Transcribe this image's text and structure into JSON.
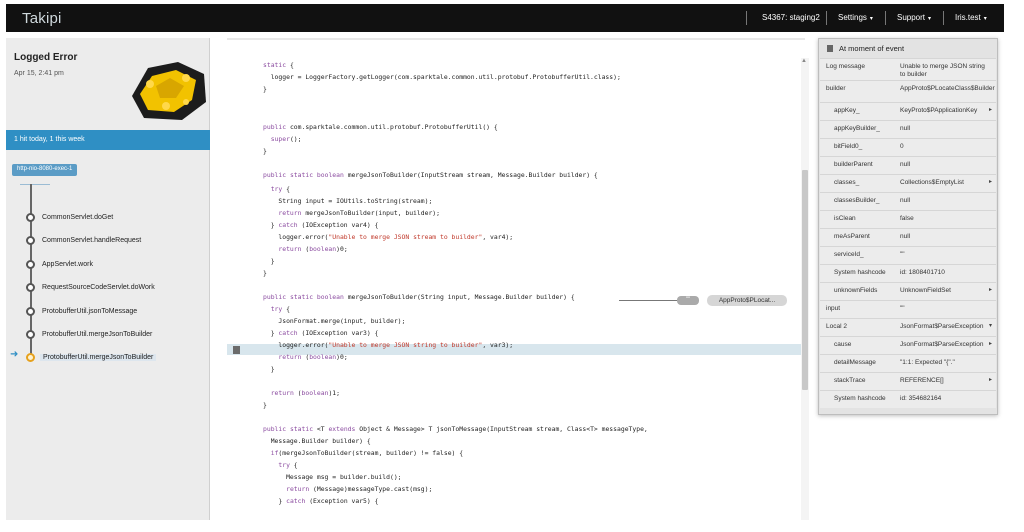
{
  "topbar": {
    "logo": "Takipi",
    "env": "S4367: staging2",
    "settings": "Settings",
    "support": "Support",
    "user": "Iris.test",
    "caret": "▾"
  },
  "left": {
    "title": "Logged Error",
    "datetime": "Apr 15, 2:41 pm",
    "hits": "1 hit today, 1 this week",
    "thread": "http-nio-8080-exec-1",
    "frames": [
      "CommonServlet.doGet",
      "CommonServlet.handleRequest",
      "AppServlet.work",
      "RequestSourceCodeServlet.doWork",
      "ProtobufferUtil.jsonToMessage",
      "ProtobufferUtil.mergeJsonToBuilder",
      "ProtobufferUtil.mergeJsonToBuilder"
    ]
  },
  "code": {
    "lines": [
      "static {",
      "  logger = LoggerFactory.getLogger(com.sparktale.common.util.protobuf.ProtobufferUtil.class);",
      "}",
      "",
      "",
      "public com.sparktale.common.util.protobuf.ProtobufferUtil() {",
      "  super();",
      "}",
      "",
      "public static boolean mergeJsonToBuilder(InputStream stream, Message.Builder builder) {",
      "  try {",
      "    String input = IOUtils.toString(stream);",
      "    return mergeJsonToBuilder(input, builder);",
      "  } catch (IOException var4) {",
      "    logger.error(\"Unable to merge JSON stream to builder\", var4);",
      "    return (boolean)0;",
      "  }",
      "}",
      "",
      "public static boolean mergeJsonToBuilder(String input, Message.Builder builder) {",
      "  try {",
      "    JsonFormat.merge(input, builder);",
      "  } catch (IOException var3) {",
      "    logger.error(\"Unable to merge JSON string to builder\", var3);",
      "    return (boolean)0;",
      "  }",
      "",
      "  return (boolean)1;",
      "}",
      "",
      "public static <T extends Object & Message> T jsonToMessage(InputStream stream, Class<T> messageType,",
      "  Message.Builder builder) {",
      "  if(mergeJsonToBuilder(stream, builder) != false) {",
      "    try {",
      "      Message msg = builder.build();",
      "      return (Message)messageType.cast(msg);",
      "    } catch (Exception var5) {"
    ],
    "pill_short": "\"\"",
    "pill_value": "AppProto$PLocat..."
  },
  "panel": {
    "header": "At moment of event",
    "rows": [
      {
        "key": "Log message",
        "value": "Unable to merge JSON string to builder",
        "expand": ""
      },
      {
        "key": "builder",
        "value": "AppProto$PLocateClass$Builder",
        "expand": ""
      },
      {
        "key": "appKey_",
        "value": "KeyProto$PApplicationKey",
        "expand": "▸"
      },
      {
        "key": "appKeyBuilder_",
        "value": "null",
        "expand": ""
      },
      {
        "key": "bitField0_",
        "value": "0",
        "expand": ""
      },
      {
        "key": "builderParent",
        "value": "null",
        "expand": ""
      },
      {
        "key": "classes_",
        "value": "Collections$EmptyList",
        "expand": "▸"
      },
      {
        "key": "classesBuilder_",
        "value": "null",
        "expand": ""
      },
      {
        "key": "isClean",
        "value": "false",
        "expand": ""
      },
      {
        "key": "meAsParent",
        "value": "null",
        "expand": ""
      },
      {
        "key": "serviceId_",
        "value": "\"\"",
        "expand": ""
      },
      {
        "key": "System hashcode",
        "value": "id: 1808401710",
        "expand": ""
      },
      {
        "key": "unknownFields",
        "value": "UnknownFieldSet",
        "expand": "▸"
      },
      {
        "key": "input",
        "value": "\"\"",
        "expand": ""
      },
      {
        "key": "Local 2",
        "value": "JsonFormat$ParseException",
        "expand": "▾"
      },
      {
        "key": "cause",
        "value": "JsonFormat$ParseException",
        "expand": "▸"
      },
      {
        "key": "detailMessage",
        "value": "\"1:1: Expected \"{\".\"",
        "expand": ""
      },
      {
        "key": "stackTrace",
        "value": "REFERENCE[]",
        "expand": "▸"
      },
      {
        "key": "System hashcode",
        "value": "id: 354682164",
        "expand": ""
      }
    ]
  }
}
